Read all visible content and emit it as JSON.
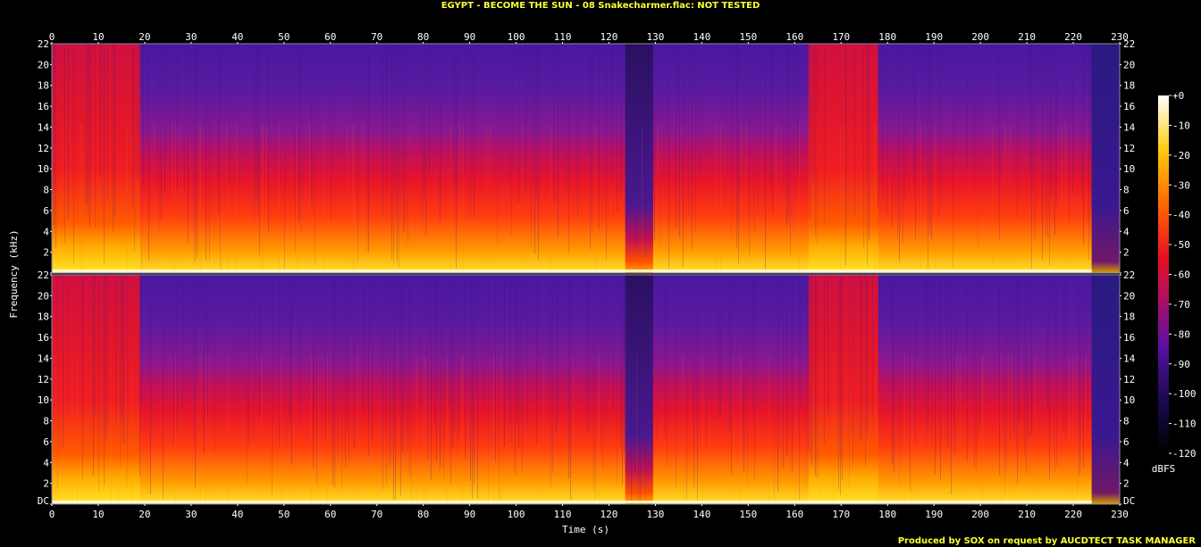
{
  "title": "EGYPT - BECOME THE SUN - 08 Snakecharmer.flac: NOT TESTED",
  "footer": "Produced by SOX on request by AUCDTECT TASK MANAGER",
  "colors": {
    "background": "#000000",
    "title": "#ffff33",
    "axis_text": "#ffffff"
  },
  "chart_data": {
    "type": "heatmap",
    "xlabel": "Time (s)",
    "ylabel": "Frequency (kHz)",
    "xlim": [
      0,
      230
    ],
    "ylim": [
      0,
      22
    ],
    "x_ticks": [
      "0",
      "10",
      "20",
      "30",
      "40",
      "50",
      "60",
      "70",
      "80",
      "90",
      "100",
      "110",
      "120",
      "130",
      "140",
      "150",
      "160",
      "170",
      "180",
      "190",
      "200",
      "210",
      "220",
      "230"
    ],
    "y_ticks": [
      "DC",
      "2",
      "4",
      "6",
      "8",
      "10",
      "12",
      "14",
      "16",
      "18",
      "20",
      "22"
    ],
    "channels": 2,
    "colorbar": {
      "label": "dBFS",
      "range": [
        -120,
        0
      ],
      "ticks": [
        "+0",
        "-10",
        "-20",
        "-30",
        "-40",
        "-50",
        "-60",
        "-70",
        "-80",
        "-90",
        "-100",
        "-110",
        "-120"
      ]
    },
    "audio_end_s": 224,
    "loud_sections_s": [
      [
        0,
        19
      ],
      [
        163,
        178
      ]
    ],
    "quiet_gaps_s": [
      [
        123.5,
        129.5
      ]
    ]
  }
}
